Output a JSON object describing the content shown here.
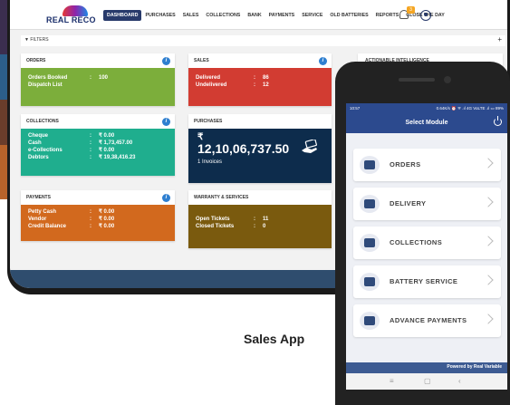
{
  "dashboard": {
    "logo_text": "REAL RECO",
    "nav": [
      "DASHBOARD",
      "PURCHASES",
      "SALES",
      "COLLECTIONS",
      "BANK",
      "PAYMENTS",
      "SERVICE",
      "OLD BATTERIES",
      "REPORTS",
      "CLOSE THE DAY"
    ],
    "notification_count": "3",
    "filters_label": "FILTERS",
    "panels": {
      "orders": {
        "title": "ORDERS",
        "rows": [
          {
            "label": "Orders Booked",
            "sep": ":",
            "value": "100"
          },
          {
            "label": "Dispatch List",
            "sep": "",
            "value": ""
          }
        ]
      },
      "sales": {
        "title": "SALES",
        "rows": [
          {
            "label": "Delivered",
            "sep": ":",
            "value": "86"
          },
          {
            "label": "Undelivered",
            "sep": ":",
            "value": "12"
          }
        ]
      },
      "collections": {
        "title": "COLLECTIONS",
        "rows": [
          {
            "label": "Cheque",
            "sep": ":",
            "value": "₹ 0.00"
          },
          {
            "label": "Cash",
            "sep": ":",
            "value": "₹ 1,73,457.00"
          },
          {
            "label": "e-Collections",
            "sep": ":",
            "value": "₹ 0.00"
          },
          {
            "label": "Debtors",
            "sep": ":",
            "value": "₹ 19,38,416.23"
          }
        ]
      },
      "purchases": {
        "title": "PURCHASES",
        "currency": "₹",
        "amount": "12,10,06,737.50",
        "invoices": "1 Invoices"
      },
      "payments": {
        "title": "PAYMENTS",
        "rows": [
          {
            "label": "Petty Cash",
            "sep": ":",
            "value": "₹ 0.00"
          },
          {
            "label": "Vendor",
            "sep": ":",
            "value": "₹ 0.00"
          },
          {
            "label": "Credit Balance",
            "sep": ":",
            "value": "₹ 0.00"
          }
        ]
      },
      "warranty": {
        "title": "WARRANTY & SERVICES",
        "rows": [
          {
            "label": "Open Tickets",
            "sep": ":",
            "value": "11"
          },
          {
            "label": "Closed Tickets",
            "sep": ":",
            "value": "0"
          }
        ]
      },
      "actionable": {
        "title": "ACTIONABLE INTELLIGENCE"
      }
    },
    "colors": {
      "orders": "#7cae3b",
      "sales": "#d23c32",
      "collections": "#1fae8e",
      "purchases": "#0d2c4c",
      "payments": "#d2691e",
      "warranty": "#7a5a0e",
      "nav_active": "#283a6b",
      "info": "#2e7fd0"
    }
  },
  "caption": "Sales App",
  "phone": {
    "status_left": "10:57",
    "status_right": "0.64K/s ⏰ ᯤ .ıl 4G VoLTE .ıl ▭ 89%",
    "header_title": "Select Module",
    "menu": [
      {
        "label": "ORDERS",
        "icon": "clipboard-icon"
      },
      {
        "label": "DELIVERY",
        "icon": "truck-icon"
      },
      {
        "label": "COLLECTIONS",
        "icon": "money-bag-icon"
      },
      {
        "label": "BATTERY SERVICE",
        "icon": "battery-icon"
      },
      {
        "label": "ADVANCE PAYMENTS",
        "icon": "handshake-money-icon"
      }
    ],
    "footer": "Powered by Real Variable",
    "nav_icons": [
      "≡",
      "▢",
      "‹"
    ],
    "header_color": "#2c4a8e"
  }
}
